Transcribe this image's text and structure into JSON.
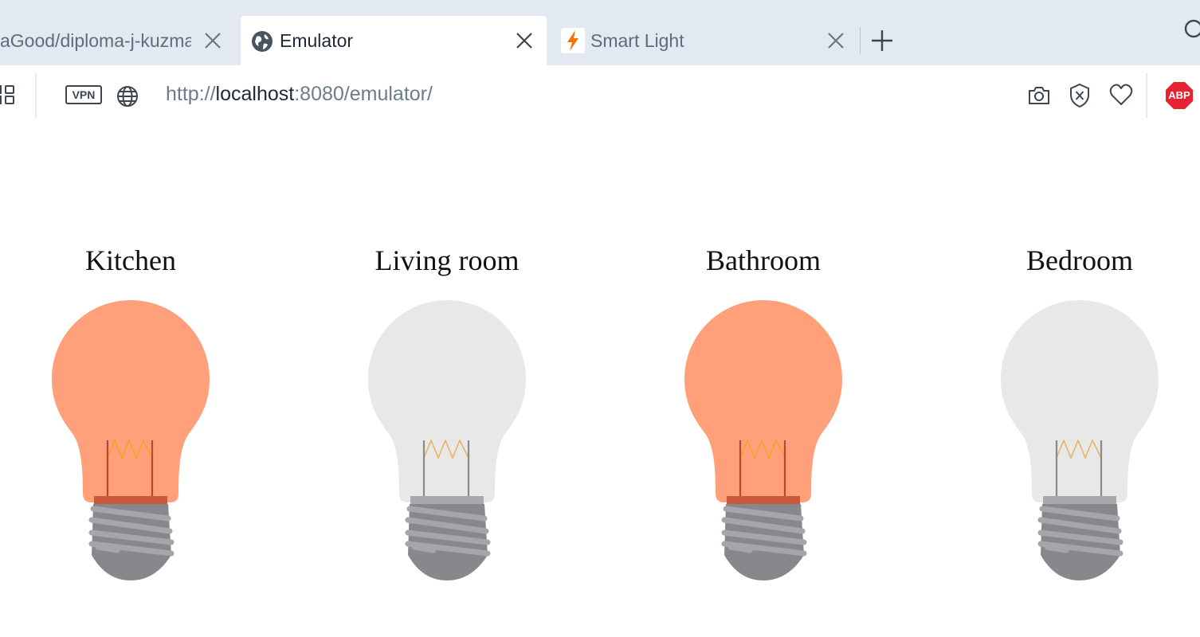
{
  "browser": {
    "tabs": [
      {
        "label": "aGood/diploma-j-kuzma",
        "icon": "github-icon",
        "active": false
      },
      {
        "label": "Emulator",
        "icon": "globe-icon",
        "active": true
      },
      {
        "label": "Smart Light",
        "icon": "lightning-icon",
        "active": false
      }
    ],
    "address": {
      "scheme": "http://",
      "host": "localhost",
      "rest": ":8080/emulator/"
    },
    "vpn_label": "VPN",
    "adblock_label": "ABP"
  },
  "rooms": [
    {
      "name": "Kitchen",
      "on": true
    },
    {
      "name": "Living room",
      "on": false
    },
    {
      "name": "Bathroom",
      "on": true
    },
    {
      "name": "Bedroom",
      "on": false
    }
  ],
  "colors": {
    "bulb_on": "#ffa07a",
    "bulb_on_collar": "#c9583c",
    "bulb_on_wire": "#b24a32",
    "bulb_off": "#e7e8e7",
    "bulb_off_collar": "#a8a9aa",
    "bulb_off_wire": "#8b8b8b",
    "filament_on": "#f7a12a",
    "filament_off": "#e8b366",
    "base": "#86888c",
    "base_thread": "#a4a6a9",
    "accent_tab": "#ff6f00",
    "abp_red": "#e62233"
  }
}
